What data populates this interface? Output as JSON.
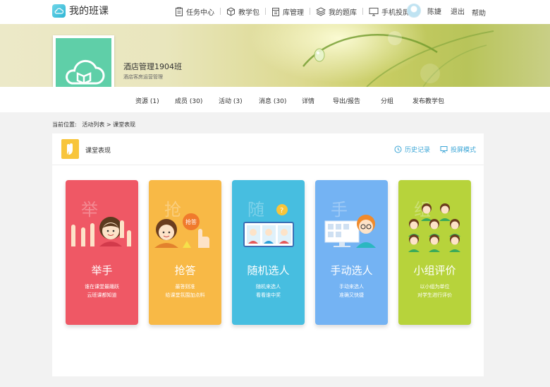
{
  "app": {
    "title": "我的班课"
  },
  "nav": [
    {
      "label": "任务中心",
      "icon": "task-icon"
    },
    {
      "label": "教学包",
      "icon": "package-icon"
    },
    {
      "label": "库管理",
      "icon": "library-icon"
    },
    {
      "label": "我的题库",
      "icon": "question-bank-icon"
    },
    {
      "label": "手机投屏",
      "icon": "screen-cast-icon"
    }
  ],
  "user": {
    "name": "陈婕",
    "logout": "退出",
    "help": "帮助"
  },
  "class_info": {
    "name": "酒店管理1904班",
    "course": "酒店客房运营管理"
  },
  "tabs": [
    "资源 (1)",
    "成员 (30)",
    "活动 (3)",
    "消息 (30)",
    "详情",
    "导出/报告",
    "分组",
    "发布教学包"
  ],
  "breadcrumb": {
    "prefix": "当前位置:",
    "path": "活动列表 > 课堂表现"
  },
  "panel": {
    "title": "课堂表现",
    "history": "历史记录",
    "projection": "投屏模式"
  },
  "cards": [
    {
      "ghost": "举",
      "title": "举手",
      "desc1": "谁在课堂最踊跃",
      "desc2": "云班课都知道",
      "color": "#ef5865"
    },
    {
      "ghost": "抢",
      "title": "抢答",
      "desc1": "最答则准",
      "desc2": "给课堂氛围加点料",
      "badge": "抢答",
      "color": "#f8b946"
    },
    {
      "ghost": "随",
      "title": "随机选人",
      "desc1": "随机来选人",
      "desc2": "看看谁中奖",
      "color": "#47bee0"
    },
    {
      "ghost": "手",
      "title": "手动选人",
      "desc1": "手动来选人",
      "desc2": "准确又快捷",
      "color": "#74b3f3"
    },
    {
      "ghost": "组",
      "title": "小组评价",
      "desc1": "以小组为单位",
      "desc2": "对学生进行评价",
      "color": "#b7d33b"
    }
  ]
}
